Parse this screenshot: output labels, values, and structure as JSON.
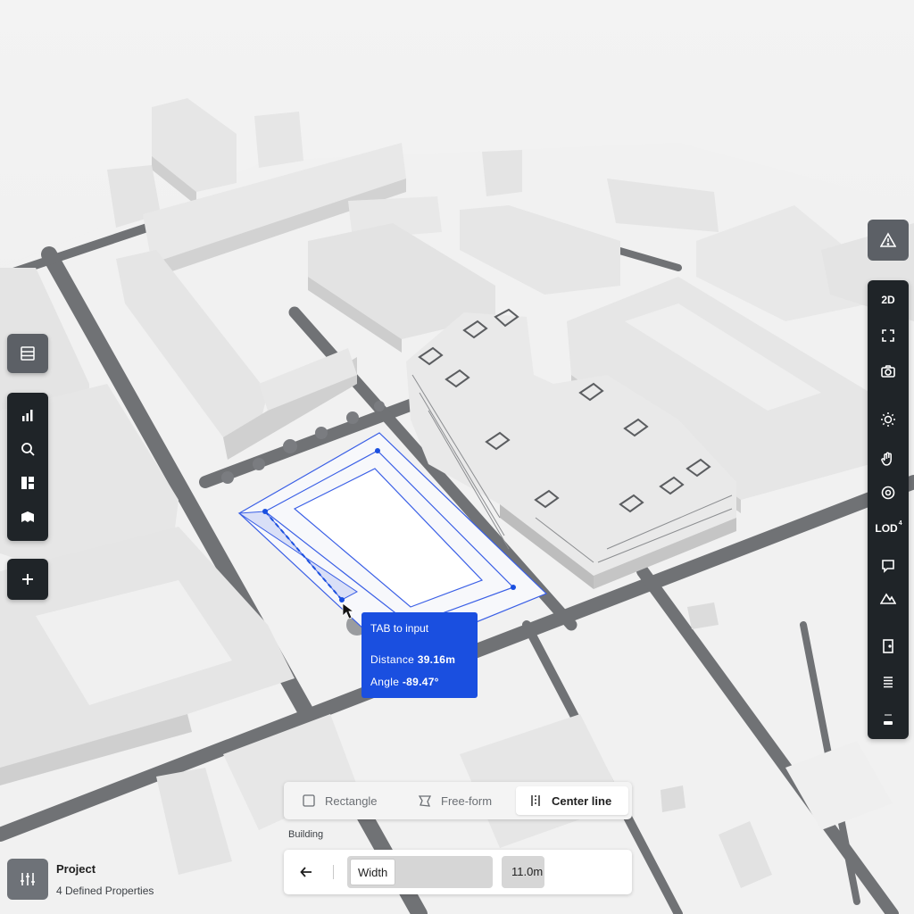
{
  "tooltip": {
    "hint": "TAB to input",
    "distance_label": "Distance",
    "distance_value": "39.16m",
    "angle_label": "Angle",
    "angle_value": "-89.47°"
  },
  "drawing_modes": {
    "items": [
      {
        "label": "Rectangle",
        "icon": "square-icon",
        "active": false
      },
      {
        "label": "Free-form",
        "icon": "freeform-icon",
        "active": false
      },
      {
        "label": "Center line",
        "icon": "center-line-icon",
        "active": true
      }
    ]
  },
  "building_panel": {
    "label": "Building",
    "field_label": "Width",
    "field_value": "11.0m"
  },
  "project": {
    "title": "Project",
    "subtitle": "4 Defined Properties"
  },
  "right_toolbar": {
    "items": [
      {
        "label": "2D"
      },
      {
        "icon": "fullscreen-icon"
      },
      {
        "icon": "camera-icon"
      },
      {
        "icon": "sun-icon"
      },
      {
        "icon": "drag-hand-icon"
      },
      {
        "icon": "eye-icon"
      },
      {
        "label": "LOD",
        "superscript": "4"
      },
      {
        "icon": "comment-icon"
      },
      {
        "icon": "terrain-icon"
      },
      {
        "icon": "door-icon"
      },
      {
        "icon": "layers-icon"
      },
      {
        "icon": "level-icon"
      }
    ]
  },
  "left_toolbar": {
    "items": [
      {
        "icon": "bar-chart-icon"
      },
      {
        "icon": "search-icon"
      },
      {
        "icon": "dashboard-icon"
      },
      {
        "icon": "map-icon"
      }
    ]
  },
  "colors": {
    "accent": "#1a4fe0",
    "toolbar": "#1f2428",
    "ground": "#ececec",
    "road": "#6d6f72",
    "building": "#e2e2e2"
  }
}
